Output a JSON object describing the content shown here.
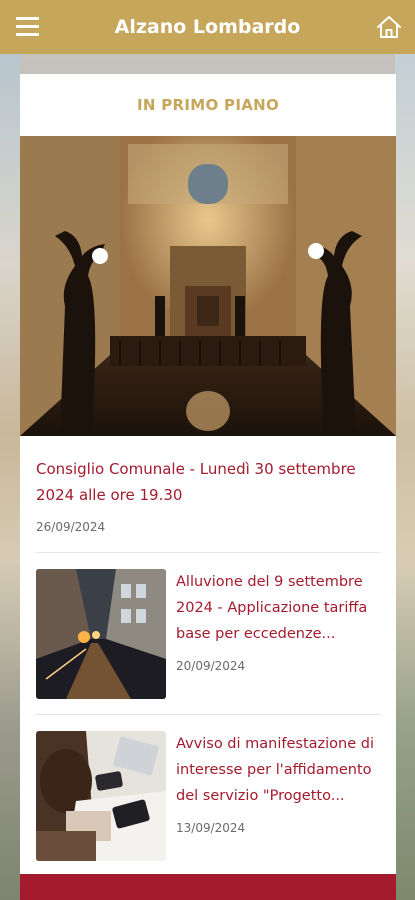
{
  "app": {
    "title": "Alzano Lombardo",
    "menu_icon": "hamburger-menu-icon",
    "home_icon": "home-icon"
  },
  "section": {
    "title": "IN PRIMO PIANO"
  },
  "featured": {
    "title": "Consiglio Comunale - Lunedì 30 settembre 2024 alle ore 19.30",
    "date": "26/09/2024"
  },
  "news": [
    {
      "title": "Alluvione del 9 settembre 2024 - Applicazione tariffa base per eccedenze...",
      "date": "20/09/2024"
    },
    {
      "title": "Avviso di manifestazione di interesse per l'affidamento del servizio \"Progetto...",
      "date": "13/09/2024"
    }
  ],
  "colors": {
    "brand_gold": "#c5a65a",
    "accent_red": "#a31b2d"
  }
}
